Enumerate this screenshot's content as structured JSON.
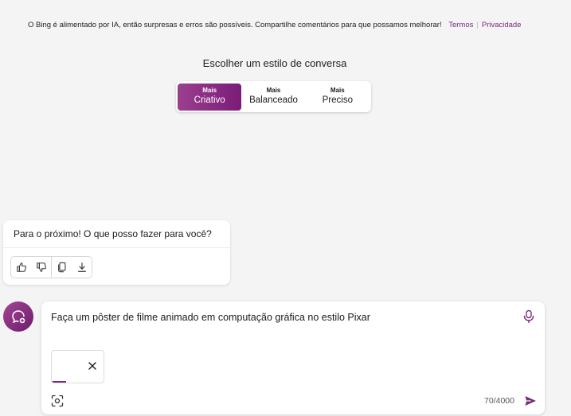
{
  "disclaimer": {
    "text": "O Bing é alimentado por IA, então surpresas e erros são possíveis. Compartilhe comentários para que possamos melhorar!",
    "terms_link": "Termos",
    "privacy_link": "Privacidade"
  },
  "style_selector": {
    "title": "Escolher um estilo de conversa",
    "options": [
      {
        "prefix": "Mais",
        "label": "Criativo",
        "active": true
      },
      {
        "prefix": "Mais",
        "label": "Balanceado",
        "active": false
      },
      {
        "prefix": "Mais",
        "label": "Preciso",
        "active": false
      }
    ]
  },
  "bot_message": {
    "text": "Para o próximo! O que posso fazer para você?",
    "actions": [
      "thumbs-up-icon",
      "thumbs-down-icon",
      "copy-icon",
      "download-icon"
    ]
  },
  "new_topic": {
    "icon": "new-topic-icon"
  },
  "input": {
    "value": "Faça um pôster de filme animado em computação gráfica no estilo Pixar",
    "char_count": "70/4000",
    "attachment_progress": 0.28
  },
  "colors": {
    "accent": "#7a2a7e",
    "accent_gradient_start": "#9b3f8e",
    "accent_gradient_end": "#7a1c78",
    "background": "#f4f4f4"
  }
}
